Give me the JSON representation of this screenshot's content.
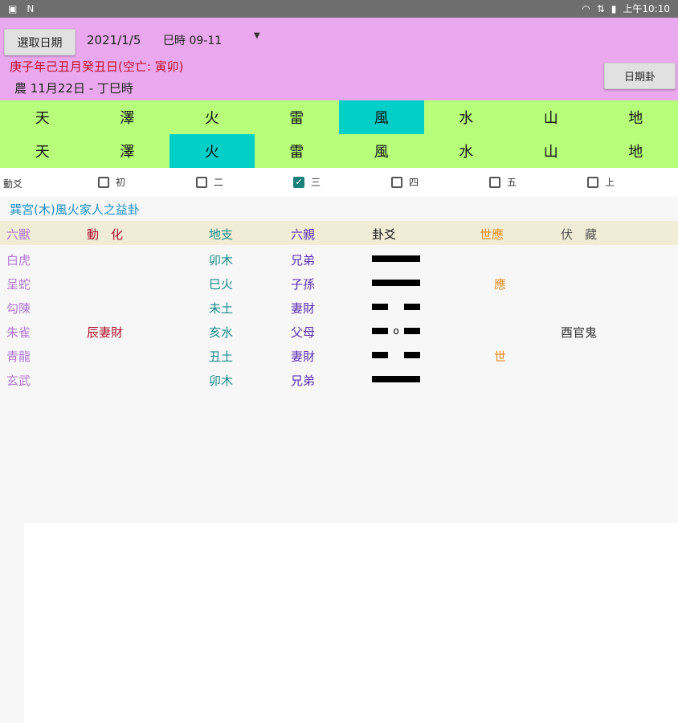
{
  "status_bar": {
    "left_icons": [
      "image-icon",
      "n-icon"
    ],
    "time": "上午10:10"
  },
  "header": {
    "select_date_label": "選取日期",
    "date": "2021/1/5",
    "hour": "巳時 09-11",
    "ganzhi": "庚子年己丑月癸丑日(空亡: 寅卯)",
    "lunar": "農 11月22日 - 丁巳時",
    "day_gua_label": "日期卦"
  },
  "trigrams_upper": {
    "items": [
      "天",
      "澤",
      "火",
      "雷",
      "風",
      "水",
      "山",
      "地"
    ],
    "selected_index": 4
  },
  "trigrams_lower": {
    "items": [
      "天",
      "澤",
      "火",
      "雷",
      "風",
      "水",
      "山",
      "地"
    ],
    "selected_index": 2
  },
  "moving_lines": {
    "label": "動爻",
    "options": [
      {
        "label": "初",
        "checked": false
      },
      {
        "label": "二",
        "checked": false
      },
      {
        "label": "三",
        "checked": true
      },
      {
        "label": "四",
        "checked": false
      },
      {
        "label": "五",
        "checked": false
      },
      {
        "label": "上",
        "checked": false
      }
    ]
  },
  "gua_title": "巽宮(木)風火家人之益卦",
  "table": {
    "headers": {
      "beast": "六獸",
      "change": "動　化",
      "branch": "地支",
      "kin": "六親",
      "yao": "卦爻",
      "shiying": "世應",
      "hidden": "伏　藏"
    },
    "rows": [
      {
        "beast": "白虎",
        "change": "",
        "branch": "卯木",
        "kin": "兄弟",
        "yao": "yang",
        "shiying": "",
        "hidden": ""
      },
      {
        "beast": "呈蛇",
        "change": "",
        "branch": "巳火",
        "kin": "子孫",
        "yao": "yang",
        "shiying": "應",
        "hidden": ""
      },
      {
        "beast": "勾陳",
        "change": "",
        "branch": "未土",
        "kin": "妻財",
        "yao": "yin",
        "shiying": "",
        "hidden": ""
      },
      {
        "beast": "朱雀",
        "change": "辰妻財",
        "branch": "亥水",
        "kin": "父母",
        "yao": "old-yin",
        "old_yin_mark": "o",
        "shiying": "",
        "hidden": "酉官鬼"
      },
      {
        "beast": "青龍",
        "change": "",
        "branch": "丑土",
        "kin": "妻財",
        "yao": "yin",
        "shiying": "世",
        "hidden": ""
      },
      {
        "beast": "玄武",
        "change": "",
        "branch": "卯木",
        "kin": "兄弟",
        "yao": "yang",
        "shiying": "",
        "hidden": ""
      }
    ]
  },
  "colors": {
    "header_bg": "#eaa9ee",
    "trigram_bg": "#b7ff7a",
    "trigram_selected": "#00cfc7",
    "ganzhi": "#c0102b",
    "gua_title": "#1a8fc4"
  }
}
